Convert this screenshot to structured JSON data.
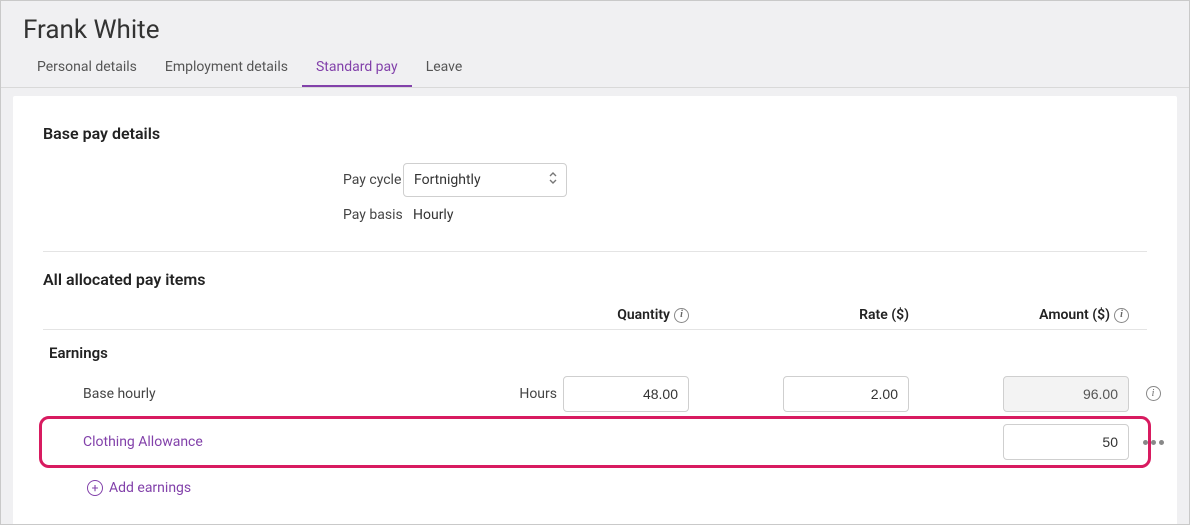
{
  "pageTitle": "Frank White",
  "tabs": [
    {
      "label": "Personal details",
      "active": false
    },
    {
      "label": "Employment details",
      "active": false
    },
    {
      "label": "Standard pay",
      "active": true
    },
    {
      "label": "Leave",
      "active": false
    }
  ],
  "basePay": {
    "sectionTitle": "Base pay details",
    "payCycleLabel": "Pay cycle",
    "payCycleValue": "Fortnightly",
    "payBasisLabel": "Pay basis",
    "payBasisValue": "Hourly"
  },
  "allocated": {
    "sectionTitle": "All allocated pay items",
    "headers": {
      "quantity": "Quantity",
      "rate": "Rate ($)",
      "amount": "Amount ($)"
    },
    "earnings": {
      "title": "Earnings",
      "rows": [
        {
          "name": "Base hourly",
          "unitLabel": "Hours",
          "quantity": "48.00",
          "rate": "2.00",
          "amount": "96.00",
          "amountReadonly": true,
          "link": false,
          "trailingIcon": "info"
        },
        {
          "name": "Clothing Allowance",
          "unitLabel": "",
          "quantity": "",
          "rate": "",
          "amount": "50",
          "amountReadonly": false,
          "link": true,
          "trailingIcon": "more",
          "highlighted": true
        }
      ],
      "addLabel": "Add earnings"
    }
  }
}
